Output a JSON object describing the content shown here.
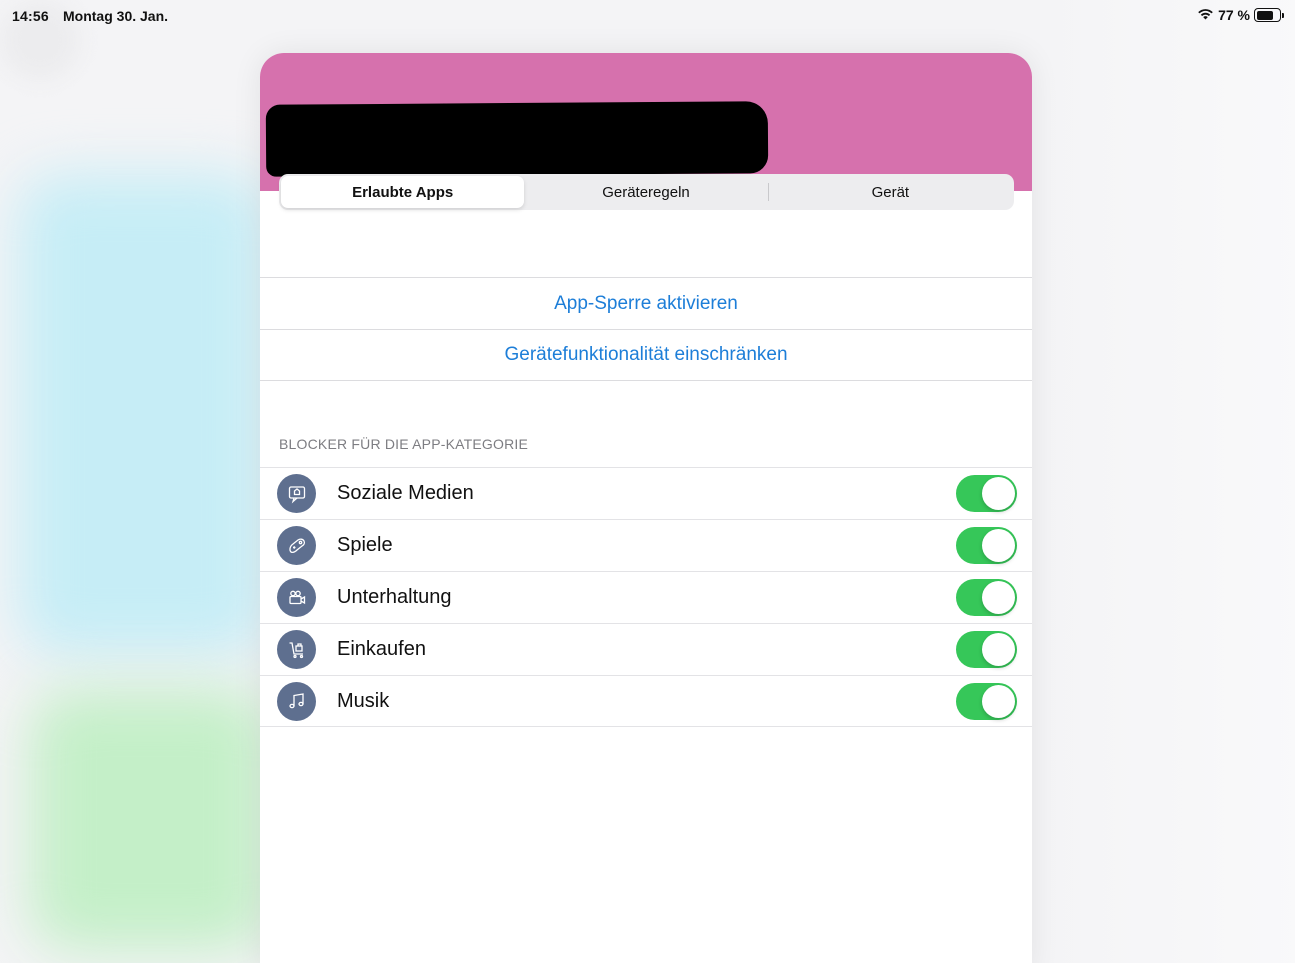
{
  "status_bar": {
    "time": "14:56",
    "date": "Montag 30. Jan.",
    "battery_text": "77 %",
    "battery_level": 0.77,
    "wifi_icon": "wifi-icon"
  },
  "header": {
    "color": "#d671ad",
    "title_redacted": true
  },
  "tabs": [
    {
      "label": "Erlaubte Apps",
      "selected": true
    },
    {
      "label": "Geräteregeln",
      "selected": false
    },
    {
      "label": "Gerät",
      "selected": false
    }
  ],
  "actions": {
    "app_lock": "App-Sperre aktivieren",
    "restrict_device": "Gerätefunktionalität einschränken",
    "link_color": "#1d7ed8"
  },
  "category_section": {
    "title": "BLOCKER FÜR DIE APP-KATEGORIE",
    "items": [
      {
        "label": "Soziale Medien",
        "icon": "social-media-icon",
        "enabled": true
      },
      {
        "label": "Spiele",
        "icon": "games-icon",
        "enabled": true
      },
      {
        "label": "Unterhaltung",
        "icon": "entertainment-icon",
        "enabled": true
      },
      {
        "label": "Einkaufen",
        "icon": "shopping-icon",
        "enabled": true
      },
      {
        "label": "Musik",
        "icon": "music-icon",
        "enabled": true
      }
    ],
    "toggle_on_color": "#36c759",
    "icon_bg_color": "#5e6f8f"
  }
}
